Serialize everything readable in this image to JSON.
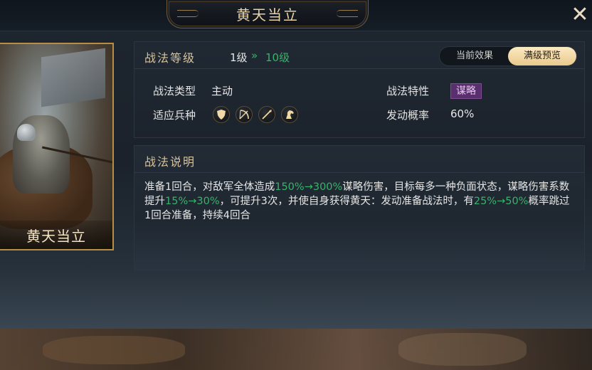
{
  "header": {
    "title": "黄天当立",
    "close_icon": "close-icon"
  },
  "card": {
    "name": "黄天当立"
  },
  "level": {
    "title": "战法等级",
    "current": "1级",
    "arrow": "»",
    "max": "10级",
    "toggle": {
      "current_effect": "当前效果",
      "max_preview": "满级预览",
      "selected": "满级预览"
    }
  },
  "attributes": {
    "type_label": "战法类型",
    "type_value": "主动",
    "trait_label": "战法特性",
    "trait_value": "谋略",
    "units_label": "适应兵种",
    "units": [
      "shield-icon",
      "bow-icon",
      "spear-icon",
      "horse-icon"
    ],
    "rate_label": "发动概率",
    "rate_value": "60%"
  },
  "description": {
    "title": "战法说明",
    "p1": "准备1回合，对敌军全体造成",
    "h1": "150%→300%",
    "p2": "谋略伤害，目标每多一种负面状态，谋略伤害系数提升",
    "h2": "15%→30%",
    "p3": "，可提升3次，并使自身获得黄天：发动准备战法时，有",
    "h3": "25%→50%",
    "p4": "概率跳过1回合准备，持续4回合"
  },
  "colors": {
    "highlight": "#38b36a",
    "gold": "#d7c29a",
    "trait_badge": "#5a2f6e",
    "toggle_active": "#f4dca8"
  }
}
